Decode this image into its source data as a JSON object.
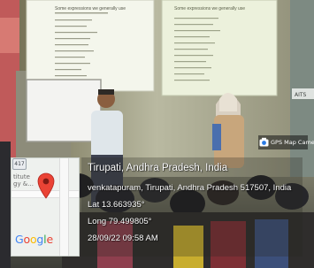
{
  "photo": {
    "description_icon": "classroom-photo"
  },
  "slides": {
    "left_title": "Some expressions we generally use",
    "right_title": "Some expressions we generally use"
  },
  "wall_sign": "AITS",
  "gps_badge": {
    "label": "GPS Map Camera",
    "icon": "camera-icon"
  },
  "map": {
    "route_number": "417",
    "place_fragment_1": "titute",
    "place_fragment_2": "gy &...",
    "logo_letters": [
      "G",
      "o",
      "o",
      "g",
      "l",
      "e"
    ],
    "logo_colors": [
      "#4285f4",
      "#ea4335",
      "#fbbc05",
      "#4285f4",
      "#34a853",
      "#ea4335"
    ],
    "pin_color": "#ea4335"
  },
  "location": {
    "title": "Tirupati, Andhra Pradesh, India",
    "address": "venkatapuram, Tirupati, Andhra Pradesh 517507, India",
    "lat": "Lat 13.663935°",
    "long": "Long 79.499805°",
    "datetime": "28/09/22 09:58 AM"
  }
}
